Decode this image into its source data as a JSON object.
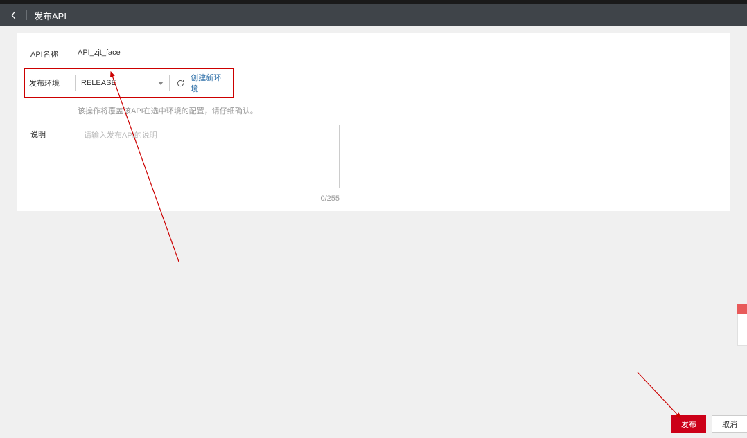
{
  "header": {
    "title": "发布API"
  },
  "form": {
    "apiName": {
      "label": "API名称",
      "value": "API_zjt_face"
    },
    "env": {
      "label": "发布环境",
      "selected": "RELEASE",
      "createLink": "创建新环境",
      "hint": "该操作将覆盖该API在选中环境的配置，请仔细确认。"
    },
    "desc": {
      "label": "说明",
      "placeholder": "请输入发布API的说明",
      "counter": "0/255"
    }
  },
  "footer": {
    "publish": "发布",
    "cancel": "取消"
  }
}
